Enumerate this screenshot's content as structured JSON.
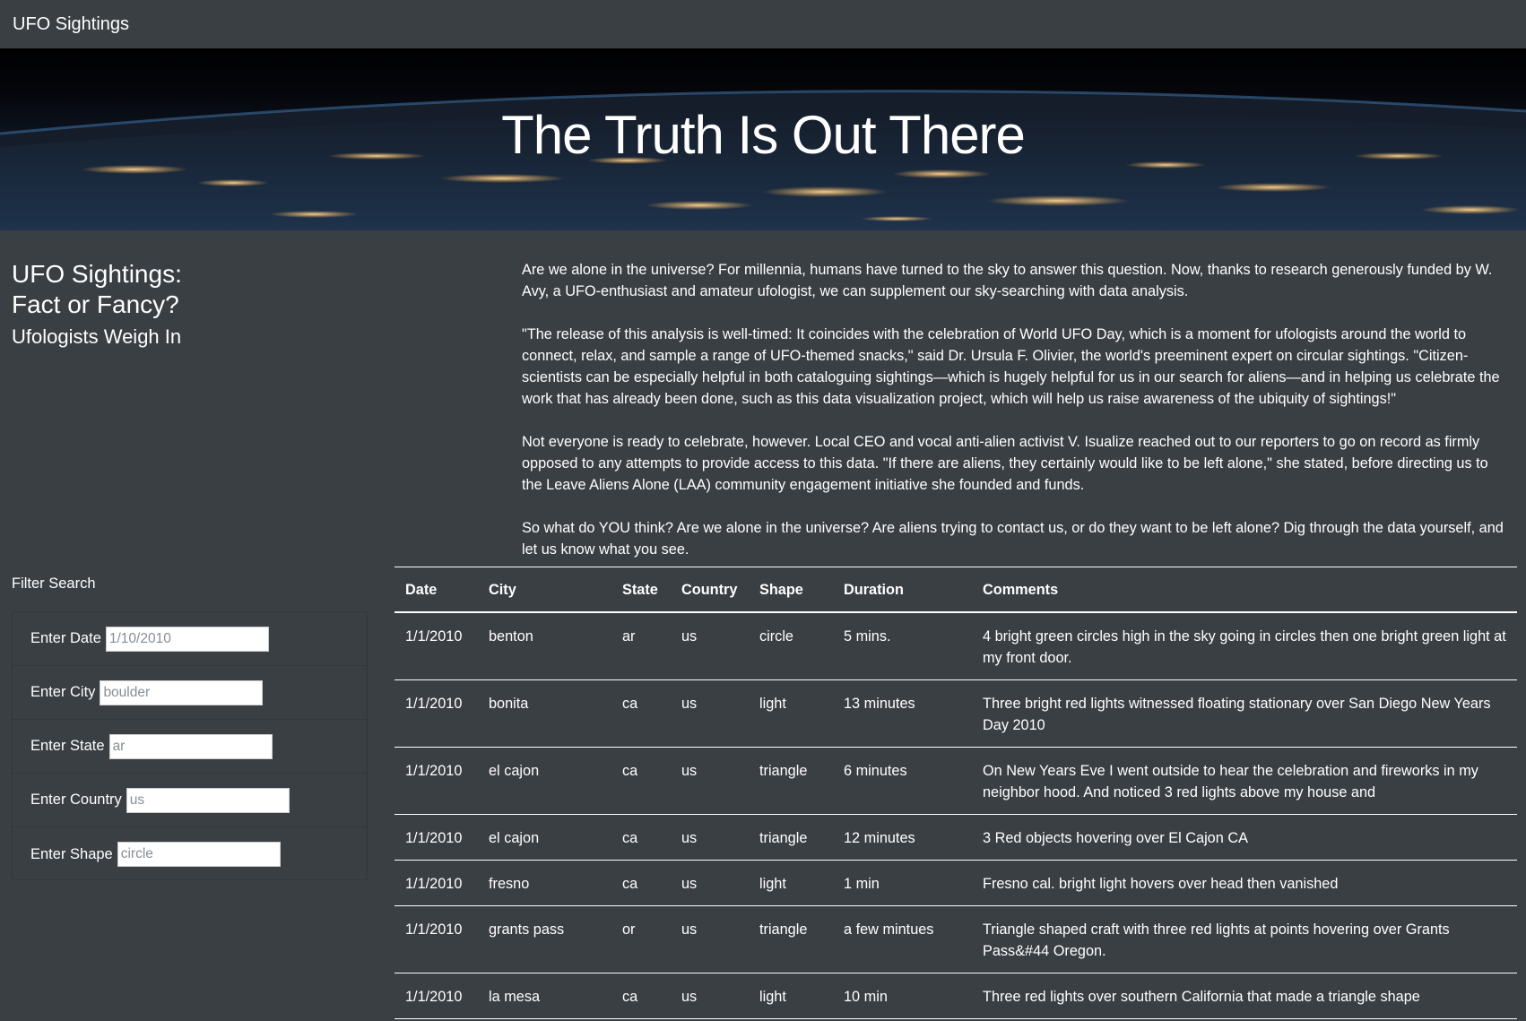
{
  "navbar": {
    "brand": "UFO Sightings"
  },
  "hero": {
    "title": "The Truth Is Out There"
  },
  "intro": {
    "title_line1": "UFO Sightings:",
    "title_line2": "Fact or Fancy?",
    "subtitle": "Ufologists Weigh In",
    "paragraphs": [
      "Are we alone in the universe? For millennia, humans have turned to the sky to answer this question. Now, thanks to research generously funded by W. Avy, a UFO-enthusiast and amateur ufologist, we can supplement our sky-searching with data analysis.",
      "\"The release of this analysis is well-timed: It coincides with the celebration of World UFO Day, which is a moment for ufologists around the world to connect, relax, and sample a range of UFO-themed snacks,\" said Dr. Ursula F. Olivier, the world's preeminent expert on circular sightings. \"Citizen-scientists can be especially helpful in both cataloguing sightings—which is hugely helpful for us in our search for aliens—and in helping us celebrate the work that has already been done, such as this data visualization project, which will help us raise awareness of the ubiquity of sightings!\"",
      "Not everyone is ready to celebrate, however. Local CEO and vocal anti-alien activist V. Isualize reached out to our reporters to go on record as firmly opposed to any attempts to provide access to this data. \"If there are aliens, they certainly would like to be left alone,\" she stated, before directing us to the Leave Aliens Alone (LAA) community engagement initiative she founded and funds.",
      "So what do YOU think? Are we alone in the universe? Are aliens trying to contact us, or do they want to be left alone? Dig through the data yourself, and let us know what you see."
    ]
  },
  "filters": {
    "title": "Filter Search",
    "date": {
      "label": "Enter Date",
      "placeholder": "1/10/2010"
    },
    "city": {
      "label": "Enter City",
      "placeholder": "boulder"
    },
    "state": {
      "label": "Enter State",
      "placeholder": "ar"
    },
    "country": {
      "label": "Enter Country",
      "placeholder": "us"
    },
    "shape": {
      "label": "Enter Shape",
      "placeholder": "circle"
    }
  },
  "table": {
    "headers": [
      "Date",
      "City",
      "State",
      "Country",
      "Shape",
      "Duration",
      "Comments"
    ],
    "rows": [
      [
        "1/1/2010",
        "benton",
        "ar",
        "us",
        "circle",
        "5 mins.",
        "4 bright green circles high in the sky going in circles then one bright green light at my front door."
      ],
      [
        "1/1/2010",
        "bonita",
        "ca",
        "us",
        "light",
        "13 minutes",
        "Three bright red lights witnessed floating stationary over San Diego New Years Day 2010"
      ],
      [
        "1/1/2010",
        "el cajon",
        "ca",
        "us",
        "triangle",
        "6 minutes",
        "On New Years Eve I went outside to hear the celebration and fireworks in my neighbor hood. And noticed 3 red lights above my house and"
      ],
      [
        "1/1/2010",
        "el cajon",
        "ca",
        "us",
        "triangle",
        "12 minutes",
        "3 Red objects hovering over El Cajon CA"
      ],
      [
        "1/1/2010",
        "fresno",
        "ca",
        "us",
        "light",
        "1 min",
        "Fresno cal. bright light hovers over head then vanished"
      ],
      [
        "1/1/2010",
        "grants pass",
        "or",
        "us",
        "triangle",
        "a few mintues",
        "Triangle shaped craft with three red lights at points hovering over Grants Pass&#44 Oregon."
      ],
      [
        "1/1/2010",
        "la mesa",
        "ca",
        "us",
        "light",
        "10 min",
        "Three red lights over southern California that made a triangle shape"
      ]
    ]
  }
}
